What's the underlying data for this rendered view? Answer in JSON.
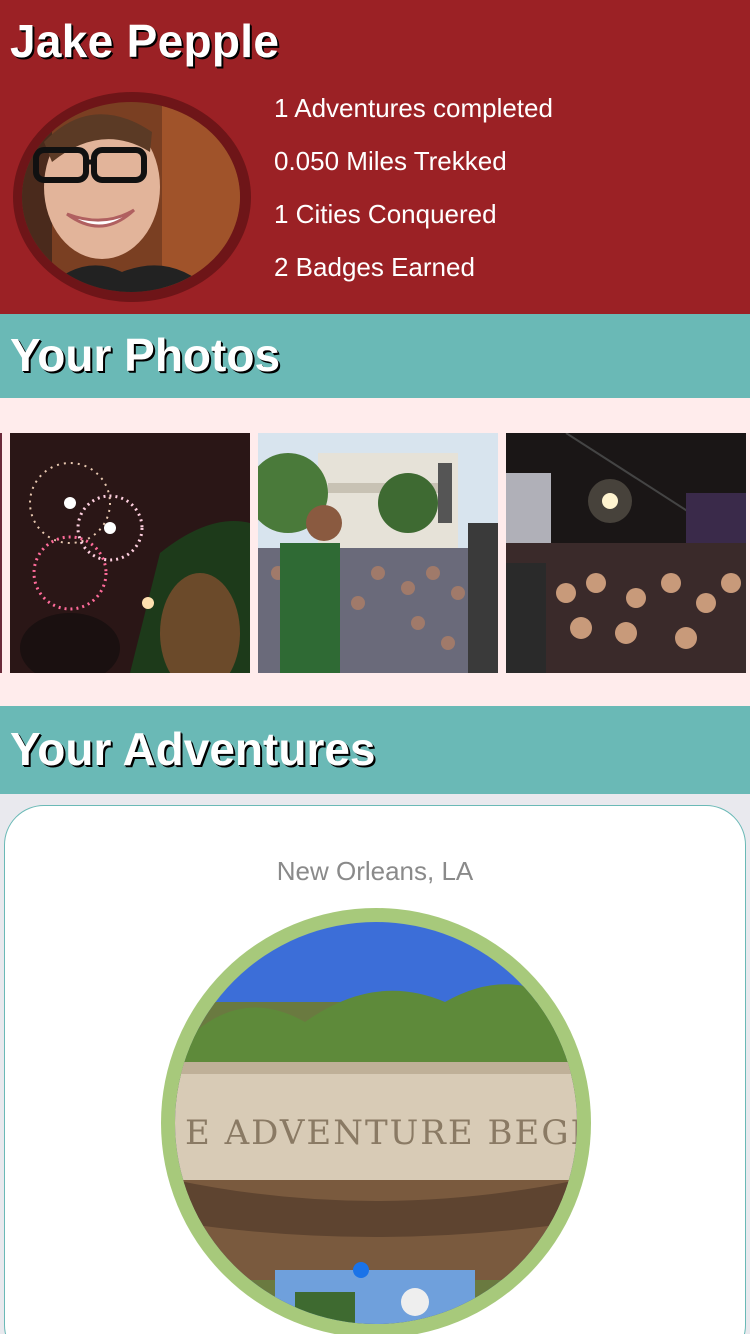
{
  "profile": {
    "name": "Jake Pepple",
    "stats": [
      "1 Adventures completed",
      "0.050 Miles Trekked",
      "1 Cities Conquered",
      "2 Badges Earned"
    ],
    "colors": {
      "header_bg": "#9b2125",
      "section_bg": "#6ab9b6"
    }
  },
  "photos_section": {
    "title": "Your Photos",
    "photos": [
      {
        "icon": "fireworks-photo"
      },
      {
        "icon": "concert-crowd-photo"
      },
      {
        "icon": "street-festival-photo"
      }
    ]
  },
  "adventures_section": {
    "title": "Your Adventures",
    "card": {
      "city": "New Orleans, LA",
      "image_text": "E ADVENTURE BEGIN",
      "ring_color": "#a7c97b"
    }
  }
}
